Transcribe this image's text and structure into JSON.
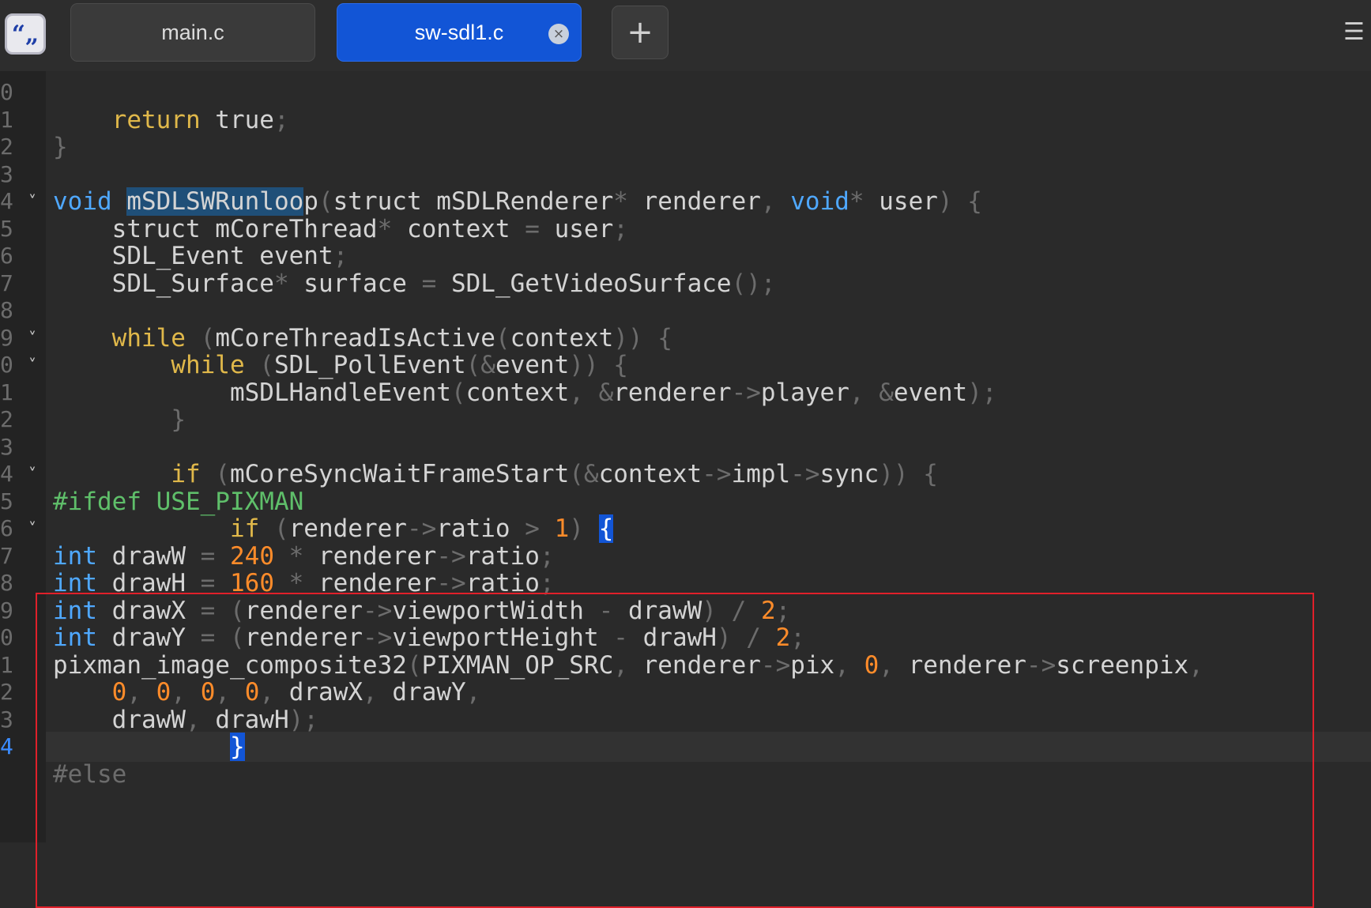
{
  "app": {
    "icon_glyph": "“„"
  },
  "tabs": [
    {
      "label": "main.c",
      "active": false
    },
    {
      "label": "sw-sdl1.c",
      "active": true,
      "close_glyph": "×"
    }
  ],
  "new_tab_glyph": "+",
  "menu_glyph": "☰",
  "editor": {
    "current_line_index": 24,
    "highlight_box_start_line": 15,
    "lines": [
      {
        "ln": "0",
        "fold": false,
        "code": ""
      },
      {
        "ln": "1",
        "fold": false,
        "code": "\t<kw>return</kw> true<p>;</p>"
      },
      {
        "ln": "2",
        "fold": false,
        "code": "<p>}</p>"
      },
      {
        "ln": "3",
        "fold": false,
        "code": ""
      },
      {
        "ln": "4",
        "fold": true,
        "code": "<ty>void</ty> <sel>mSDLSWRunloo</sel>p<p>(</p>struct mSDLRenderer<p>*</p> renderer<p>,</p> <ty>void</ty><p>*</p> user<p>)</p> <p>{</p>"
      },
      {
        "ln": "5",
        "fold": false,
        "code": "\tstruct mCoreThread<p>*</p> context <p>=</p> user<p>;</p>"
      },
      {
        "ln": "6",
        "fold": false,
        "code": "\tSDL_Event event<p>;</p>"
      },
      {
        "ln": "7",
        "fold": false,
        "code": "\tSDL_Surface<p>*</p> surface <p>=</p> SDL_GetVideoSurface<p>();</p>"
      },
      {
        "ln": "8",
        "fold": false,
        "code": ""
      },
      {
        "ln": "9",
        "fold": true,
        "code": "\t<kw>while</kw> <p>(</p>mCoreThreadIsActive<p>(</p>context<p>))</p> <p>{</p>"
      },
      {
        "ln": "0",
        "fold": true,
        "code": "\t\t<kw>while</kw> <p>(</p>SDL_PollEvent<p>(&amp;</p>event<p>))</p> <p>{</p>"
      },
      {
        "ln": "1",
        "fold": false,
        "code": "\t\t\tmSDLHandleEvent<p>(</p>context<p>,</p> <p>&amp;</p>renderer<p>-&gt;</p>player<p>,</p> <p>&amp;</p>event<p>);</p>"
      },
      {
        "ln": "2",
        "fold": false,
        "code": "\t\t<p>}</p>"
      },
      {
        "ln": "3",
        "fold": false,
        "code": ""
      },
      {
        "ln": "4",
        "fold": true,
        "code": "\t\t<kw>if</kw> <p>(</p>mCoreSyncWaitFrameStart<p>(&amp;</p>context<p>-&gt;</p>impl<p>-&gt;</p>sync<p>))</p> <p>{</p>"
      },
      {
        "ln": "5",
        "fold": false,
        "code": "<pp>#ifdef USE_PIXMAN</pp>"
      },
      {
        "ln": "6",
        "fold": true,
        "code": "\t\t\t<kw>if</kw> <p>(</p>renderer<p>-&gt;</p>ratio <p>&gt;</p> <n>1</n><p>)</p> <b>{</b>"
      },
      {
        "ln": "7",
        "fold": false,
        "code": "<ty>int</ty> drawW <p>=</p> <n>240</n> <p>*</p> renderer<p>-&gt;</p>ratio<p>;</p>"
      },
      {
        "ln": "8",
        "fold": false,
        "code": "<ty>int</ty> drawH <p>=</p> <n>160</n> <p>*</p> renderer<p>-&gt;</p>ratio<p>;</p>"
      },
      {
        "ln": "9",
        "fold": false,
        "code": "<ty>int</ty> drawX <p>=</p> <p>(</p>renderer<p>-&gt;</p>viewportWidth <p>-</p> drawW<p>)</p> <p>/</p> <n>2</n><p>;</p>"
      },
      {
        "ln": "0",
        "fold": false,
        "code": "<ty>int</ty> drawY <p>=</p> <p>(</p>renderer<p>-&gt;</p>viewportHeight <p>-</p> drawH<p>)</p> <p>/</p> <n>2</n><p>;</p>"
      },
      {
        "ln": "1",
        "fold": false,
        "code": "pixman_image_composite32<p>(</p>PIXMAN_OP_SRC<p>,</p> renderer<p>-&gt;</p>pix<p>,</p> <n>0</n><p>,</p> renderer<p>-&gt;</p>screenpix<p>,</p>"
      },
      {
        "ln": "2",
        "fold": false,
        "code": "    <n>0</n><p>,</p> <n>0</n><p>,</p> <n>0</n><p>,</p> <n>0</n><p>,</p> drawX<p>,</p> drawY<p>,</p>"
      },
      {
        "ln": "3",
        "fold": false,
        "code": "    drawW<p>,</p> drawH<p>);</p>"
      },
      {
        "ln": "4",
        "fold": false,
        "code": "\t\t\t<b>}</b>"
      },
      {
        "ln": "",
        "fold": false,
        "code": "<p>#else</p>"
      }
    ]
  },
  "colors": {
    "keyword": "#e0b84a",
    "type": "#4fa8ff",
    "preprocessor": "#5fbf6a",
    "number": "#ff8c2a",
    "punctuation": "#6c6c6c",
    "text": "#d4d4d4",
    "active_tab": "#1255d6",
    "highlight_box": "#e0202a"
  }
}
